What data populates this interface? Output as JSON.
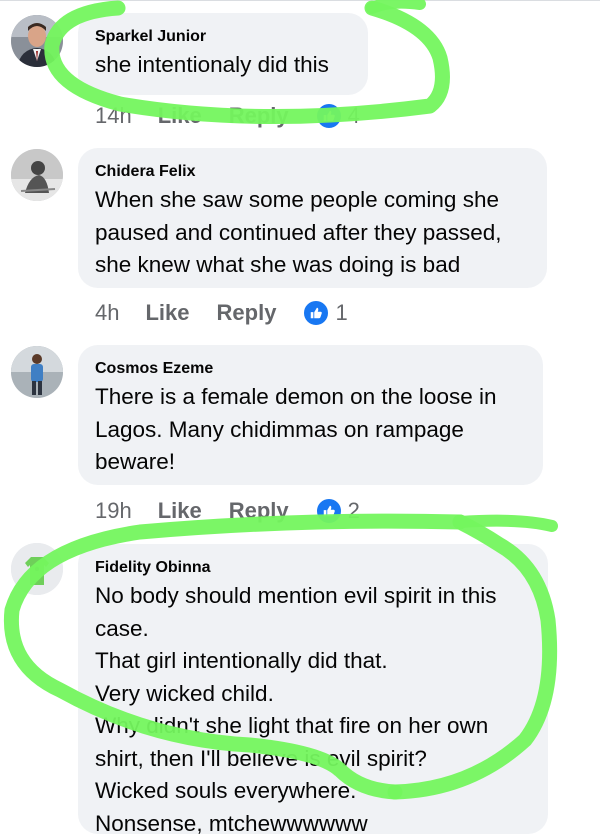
{
  "comments": [
    {
      "author": "Sparkel Junior",
      "lines": [
        "she intentionaly did this"
      ],
      "time": "14h",
      "like_label": "Like",
      "reply_label": "Reply",
      "reactions": "4",
      "avatar_icon": "profile-photo-man-suit"
    },
    {
      "author": "Chidera Felix",
      "lines": [
        "When she saw some people coming she",
        "paused and continued after they passed,",
        "she knew what she was doing is bad"
      ],
      "time": "4h",
      "like_label": "Like",
      "reply_label": "Reply",
      "reactions": "1",
      "avatar_icon": "profile-photo-grayscale"
    },
    {
      "author": "Cosmos Ezeme",
      "lines": [
        "There is a female demon on the loose in",
        "Lagos. Many chidimmas on rampage",
        "beware!"
      ],
      "time": "19h",
      "like_label": "Like",
      "reply_label": "Reply",
      "reactions": "2",
      "avatar_icon": "profile-photo-standing-man"
    },
    {
      "author": "Fidelity Obinna",
      "lines": [
        "No body should mention evil spirit in this",
        "case.",
        "That girl intentionally did that.",
        "Very wicked child.",
        "Why didn't she light that fire on her own",
        "shirt, then I'll believe is evil spirit?",
        "Wicked souls everywhere.",
        "Nonsense, mtchewwwwww"
      ],
      "avatar_icon": "profile-photo-default-avatar"
    }
  ],
  "colors": {
    "bubble": "#f0f2f5",
    "meta_text": "#65676b",
    "like_blue": "#1877f2",
    "highlight_green": "#74f55e"
  }
}
